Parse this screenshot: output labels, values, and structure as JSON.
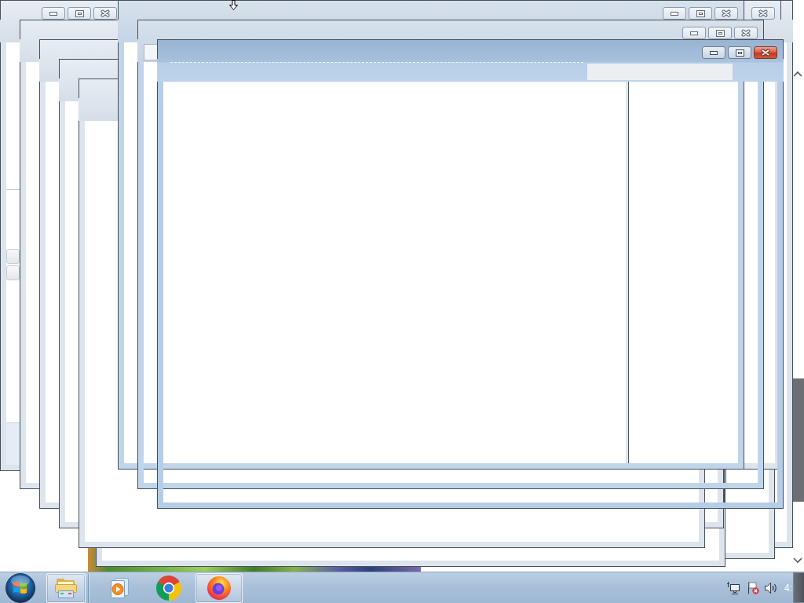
{
  "windows": [
    {
      "kind": "maximized",
      "scrollbar": true
    },
    {
      "kind": "basic"
    },
    {
      "kind": "basic"
    },
    {
      "kind": "basic"
    },
    {
      "kind": "basic",
      "caption_buttons": [
        {
          "kind": "minimize"
        },
        {
          "kind": "maximize"
        },
        {
          "kind": "close"
        }
      ],
      "pane_buttons": [
        {
          "kind": "tile"
        },
        {
          "kind": "tile"
        }
      ]
    },
    {
      "kind": "basic"
    },
    {
      "kind": "basic"
    },
    {
      "kind": "basic"
    },
    {
      "kind": "basic"
    },
    {
      "kind": "basic",
      "caption_buttons": [
        {
          "kind": "close"
        }
      ]
    },
    {
      "kind": "aero",
      "active": false,
      "details_pane": true,
      "caption_buttons": [
        {
          "kind": "minimize"
        },
        {
          "kind": "maximize"
        },
        {
          "kind": "close"
        }
      ]
    },
    {
      "kind": "aero",
      "active": false,
      "see_through": true,
      "caption_buttons": [
        {
          "kind": "minimize"
        },
        {
          "kind": "maximize"
        },
        {
          "kind": "close"
        }
      ],
      "toolbar_fields": [
        {
          "kind": "address"
        }
      ]
    },
    {
      "kind": "aero",
      "active": true,
      "see_through": true,
      "caption_buttons": [
        {
          "kind": "minimize"
        },
        {
          "kind": "maximize"
        },
        {
          "kind": "close"
        }
      ],
      "toolbar_fields": [
        {
          "kind": "search"
        }
      ]
    }
  ],
  "taskbar": {
    "items": [
      {
        "kind": "explorer",
        "running": true
      },
      {
        "kind": "media-player",
        "running": false
      },
      {
        "kind": "chrome",
        "running": false
      },
      {
        "kind": "firefox",
        "running": true
      }
    ],
    "tray": [
      {
        "kind": "network"
      },
      {
        "kind": "action-center",
        "alert": true
      },
      {
        "kind": "volume"
      }
    ],
    "clock": "4:"
  }
}
